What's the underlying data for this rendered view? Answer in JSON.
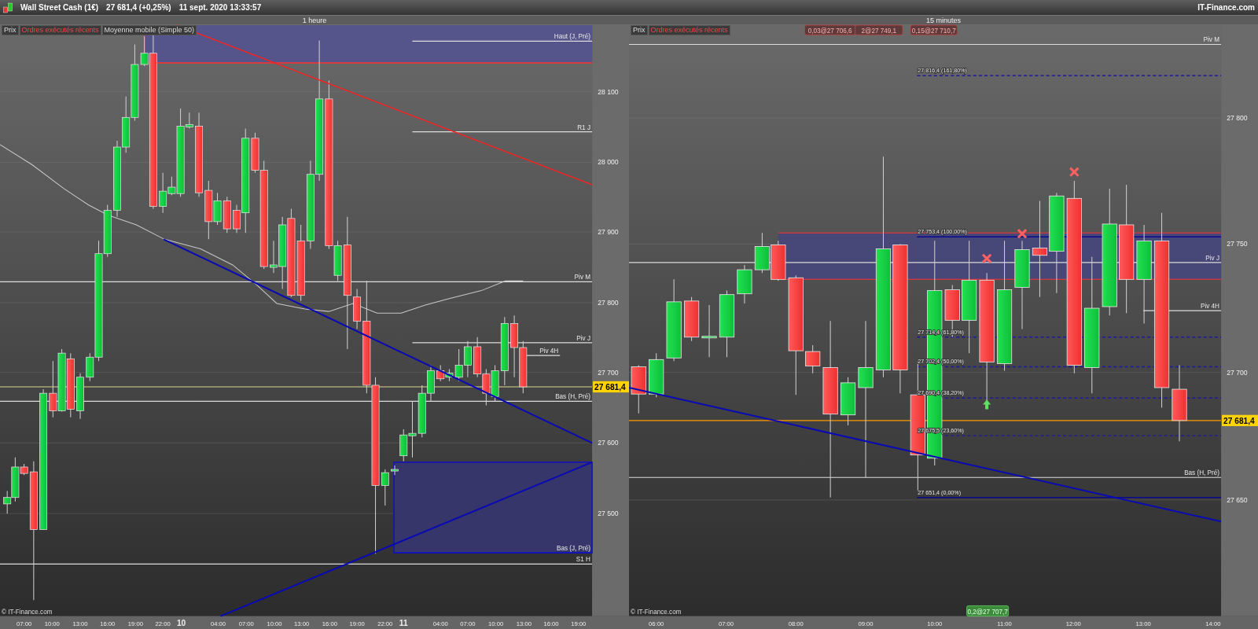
{
  "header": {
    "title": "Wall Street Cash (1€)",
    "price": "27 681,4 (+0,25%)",
    "datetime": "11 sept. 2020 13:33:57",
    "brand": "IT-Finance.com"
  },
  "charts": [
    {
      "timeframe": "1 heure",
      "legend": [
        {
          "label": "Prix",
          "kind": "plain"
        },
        {
          "label": "Ordres exécutés récents",
          "kind": "orders"
        },
        {
          "label": "Moyenne mobile (Simple 50)",
          "kind": "plain"
        }
      ],
      "levels": [
        "Haut (J, Pré)",
        "R1 J",
        "Piv M",
        "Piv J",
        "Piv 4H",
        "Bas (H, Pré)",
        "Bas (J, Pré)",
        "S1 H"
      ],
      "y_ticks": [
        "28 100",
        "28 000",
        "27 900",
        "27 800",
        "27 700",
        "27 600",
        "27 500"
      ],
      "current_price": "27 681,4",
      "x_labels": [
        "07:00",
        "10:00",
        "13:00",
        "16:00",
        "19:00",
        "22:00",
        "10",
        "04:00",
        "07:00",
        "10:00",
        "13:00",
        "16:00",
        "19:00",
        "22:00",
        "11",
        "04:00",
        "07:00",
        "10:00",
        "13:00",
        "16:00",
        "19:00"
      ],
      "copyright": "© IT-Finance.com"
    },
    {
      "timeframe": "15 minutes",
      "legend": [
        {
          "label": "Prix",
          "kind": "plain"
        },
        {
          "label": "Ordres exécutés récents",
          "kind": "orders"
        }
      ],
      "trades": [
        "0,03@27 706,6",
        "2@27 749,1",
        "0,15@27 710,7"
      ],
      "levels": [
        "Piv M",
        "Piv J",
        "Piv 4H",
        "Bas (H, Pré)"
      ],
      "fibonacci": [
        {
          "label": "27 816,4 (161,80%)",
          "kind": "dashed"
        },
        {
          "label": "27 753,4 (100,00%)",
          "kind": "solid"
        },
        {
          "label": "27 714,4 (61,80%)",
          "kind": "dashed"
        },
        {
          "label": "27 702,4 (50,00%)",
          "kind": "dashed"
        },
        {
          "label": "27 690,4 (38,20%)",
          "kind": "dashed"
        },
        {
          "label": "27 675,5 (23,60%)",
          "kind": "dashed"
        },
        {
          "label": "27 651,4 (0,00%)",
          "kind": "solid"
        }
      ],
      "y_ticks": [
        "27 800",
        "27 750",
        "27 700",
        "27 650"
      ],
      "current_price": "27 681,4",
      "open_position": "0,2@27 707,7",
      "x_labels": [
        "06:00",
        "07:00",
        "08:00",
        "09:00",
        "10:00",
        "11:00",
        "12:00",
        "13:00",
        "14:00"
      ],
      "copyright": "© IT-Finance.com"
    }
  ]
}
